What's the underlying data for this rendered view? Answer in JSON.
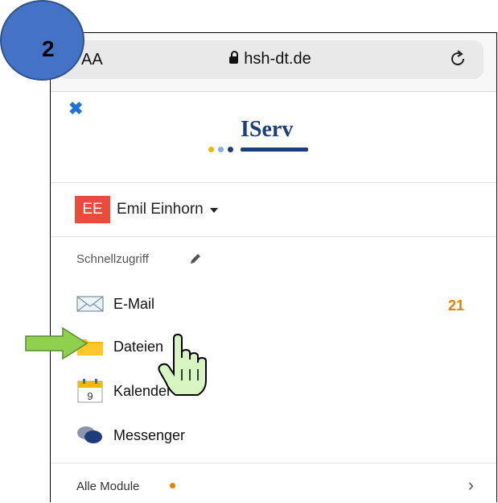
{
  "browser": {
    "aa_label": "AA",
    "domain": "hsh-dt.de"
  },
  "app": {
    "logo_text": "IServ",
    "close_icon": "close-icon",
    "accent": "#1e74d6",
    "logo_color": "#1c3d7a"
  },
  "user": {
    "initials": "EE",
    "name": "Emil Einhorn",
    "avatar_color": "#e74c3c"
  },
  "quick_access": {
    "title": "Schnellzugriff",
    "items": [
      {
        "label": "E-Mail",
        "icon": "mail-icon",
        "badge": "21"
      },
      {
        "label": "Dateien",
        "icon": "folder-icon"
      },
      {
        "label": "Kalender",
        "icon": "calendar-icon",
        "calendar_day": "9"
      },
      {
        "label": "Messenger",
        "icon": "messenger-icon"
      }
    ]
  },
  "footer": {
    "label": "Alle Module"
  },
  "annotation": {
    "step_number": "2",
    "step_color": "#4472c4",
    "arrow_color": "#8fd14f",
    "badge_color": "#ef7d00"
  }
}
